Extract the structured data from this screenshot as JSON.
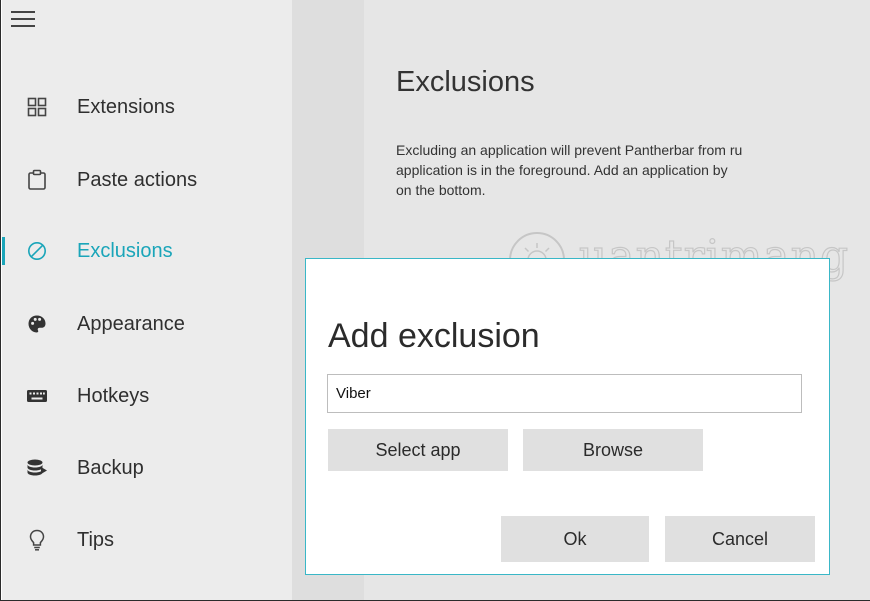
{
  "sidebar": {
    "items": [
      {
        "label": "Extensions",
        "icon": "extensions-icon"
      },
      {
        "label": "Paste actions",
        "icon": "clipboard-icon"
      },
      {
        "label": "Exclusions",
        "icon": "prohibited-icon",
        "active": true
      },
      {
        "label": "Appearance",
        "icon": "palette-icon"
      },
      {
        "label": "Hotkeys",
        "icon": "keyboard-icon"
      },
      {
        "label": "Backup",
        "icon": "database-icon"
      },
      {
        "label": "Tips",
        "icon": "lightbulb-icon"
      }
    ]
  },
  "main": {
    "title": "Exclusions",
    "description_lines": [
      "Excluding an application will prevent Pantherbar from ru",
      "application is in the foreground. Add an application by",
      "on the bottom."
    ]
  },
  "watermark": {
    "text": "uantrimang"
  },
  "dialog": {
    "title": "Add exclusion",
    "input_value": "Viber",
    "select_app_label": "Select app",
    "browse_label": "Browse",
    "ok_label": "Ok",
    "cancel_label": "Cancel"
  },
  "colors": {
    "accent": "#1aa5b9",
    "dialog_border": "#3ab7c7",
    "sidebar_bg": "#ececec",
    "content_bg": "#e6e6e6",
    "button_bg": "#e0e0e0"
  }
}
